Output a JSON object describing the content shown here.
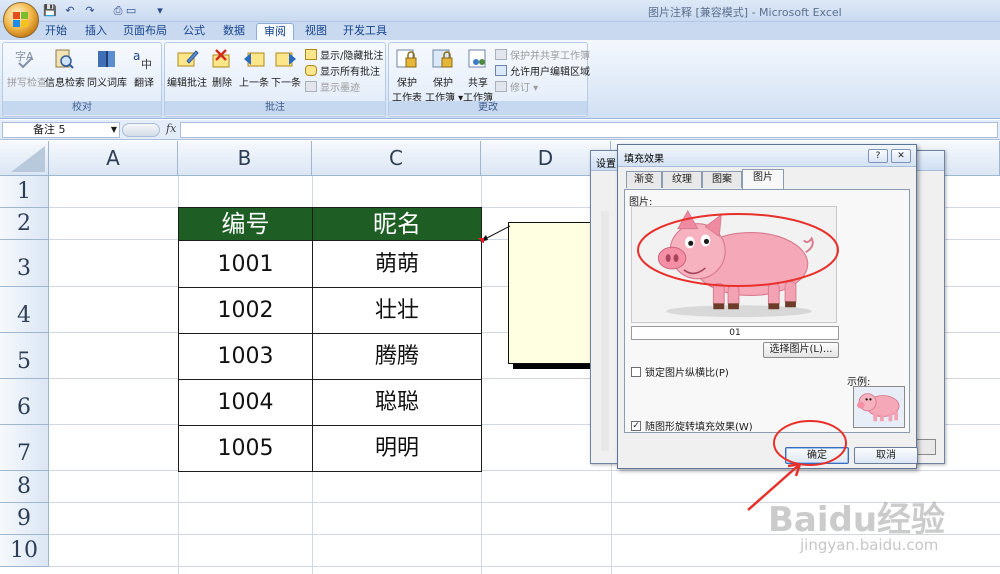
{
  "window": {
    "title": "图片注释 [兼容模式] - Microsoft Excel"
  },
  "qat": [
    "💾",
    "↶",
    "↷",
    "▾"
  ],
  "tabs": [
    {
      "label": "开始",
      "active": false
    },
    {
      "label": "插入",
      "active": false
    },
    {
      "label": "页面布局",
      "active": false
    },
    {
      "label": "公式",
      "active": false
    },
    {
      "label": "数据",
      "active": false
    },
    {
      "label": "审阅",
      "active": true
    },
    {
      "label": "视图",
      "active": false
    },
    {
      "label": "开发工具",
      "active": false
    }
  ],
  "ribbon": {
    "proofing": {
      "label": "校对",
      "buttons": [
        {
          "label": "拼写检查",
          "icon": "spellcheck-icon",
          "disabled": true
        },
        {
          "label": "信息检索",
          "icon": "research-icon",
          "disabled": false
        },
        {
          "label": "同义词库",
          "icon": "thesaurus-icon",
          "disabled": false
        },
        {
          "label": "翻译",
          "icon": "translate-icon",
          "disabled": false
        }
      ]
    },
    "comments": {
      "label": "批注",
      "buttons": [
        {
          "label": "编辑批注",
          "icon": "edit-comment-icon"
        },
        {
          "label": "删除",
          "icon": "delete-comment-icon"
        },
        {
          "label": "上一条",
          "icon": "previous-comment-icon"
        },
        {
          "label": "下一条",
          "icon": "next-comment-icon"
        }
      ],
      "small": [
        {
          "label": "显示/隐藏批注",
          "disabled": false
        },
        {
          "label": "显示所有批注",
          "disabled": false
        },
        {
          "label": "显示墨迹",
          "disabled": true
        }
      ]
    },
    "changes": {
      "label": "更改",
      "buttons": [
        {
          "label1": "保护",
          "label2": "工作表",
          "icon": "protect-sheet-icon"
        },
        {
          "label1": "保护",
          "label2": "工作簿 ▾",
          "icon": "protect-workbook-icon"
        },
        {
          "label1": "共享",
          "label2": "工作簿",
          "icon": "share-workbook-icon"
        }
      ],
      "small": [
        {
          "label": "保护并共享工作簿",
          "disabled": true
        },
        {
          "label": "允许用户编辑区域",
          "disabled": false
        },
        {
          "label": "修订 ▾",
          "disabled": true
        }
      ]
    }
  },
  "formula_bar": {
    "name_box": "备注 5",
    "fx": "fx",
    "value": ""
  },
  "grid": {
    "columns": [
      "A",
      "B",
      "C",
      "D"
    ],
    "rows": [
      "1",
      "2",
      "3",
      "4",
      "5",
      "6",
      "7",
      "8",
      "9",
      "10"
    ]
  },
  "table": {
    "headers": [
      "编号",
      "昵名"
    ],
    "rows": [
      [
        "1001",
        "萌萌"
      ],
      [
        "1002",
        "壮壮"
      ],
      [
        "1003",
        "腾腾"
      ],
      [
        "1004",
        "聪聪"
      ],
      [
        "1005",
        "明明"
      ]
    ],
    "header_color": "#1e5e24"
  },
  "back_dialog": {
    "title": "设置"
  },
  "dialog": {
    "title": "填充效果",
    "help": "?",
    "close": "✕",
    "tabs": [
      {
        "label": "渐变",
        "active": false
      },
      {
        "label": "纹理",
        "active": false
      },
      {
        "label": "图案",
        "active": false
      },
      {
        "label": "图片",
        "active": true
      }
    ],
    "picture_label": "图片:",
    "picture_name": "01",
    "select_button": "选择图片(L)...",
    "lock_aspect": {
      "label": "锁定图片纵横比(P)",
      "checked": false
    },
    "rotate_with_shape": {
      "label": "随图形旋转填充效果(W)",
      "checked": true
    },
    "sample_label": "示例:",
    "ok": "确定",
    "cancel": "取消"
  },
  "watermark": {
    "brand": "Baidu经验",
    "url": "jingyan.baidu.com"
  },
  "colors": {
    "annotation_red": "#e8302a",
    "ribbon_blue": "#15428b"
  }
}
